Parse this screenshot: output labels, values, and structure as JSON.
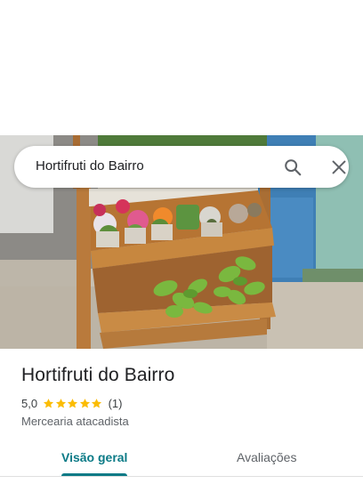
{
  "search": {
    "query": "Hortifruti do Bairro"
  },
  "place": {
    "name": "Hortifruti do Bairro",
    "rating": "5,0",
    "stars": 5,
    "reviews": "(1)",
    "category": "Mercearia atacadista"
  },
  "tabs": [
    {
      "label": "Visão geral",
      "active": true
    },
    {
      "label": "Avaliações",
      "active": false
    }
  ],
  "colors": {
    "accent": "#0b7a86",
    "star": "#fbbc04"
  },
  "icons": {
    "search": "search-icon",
    "close": "close-icon",
    "star": "star-icon"
  }
}
